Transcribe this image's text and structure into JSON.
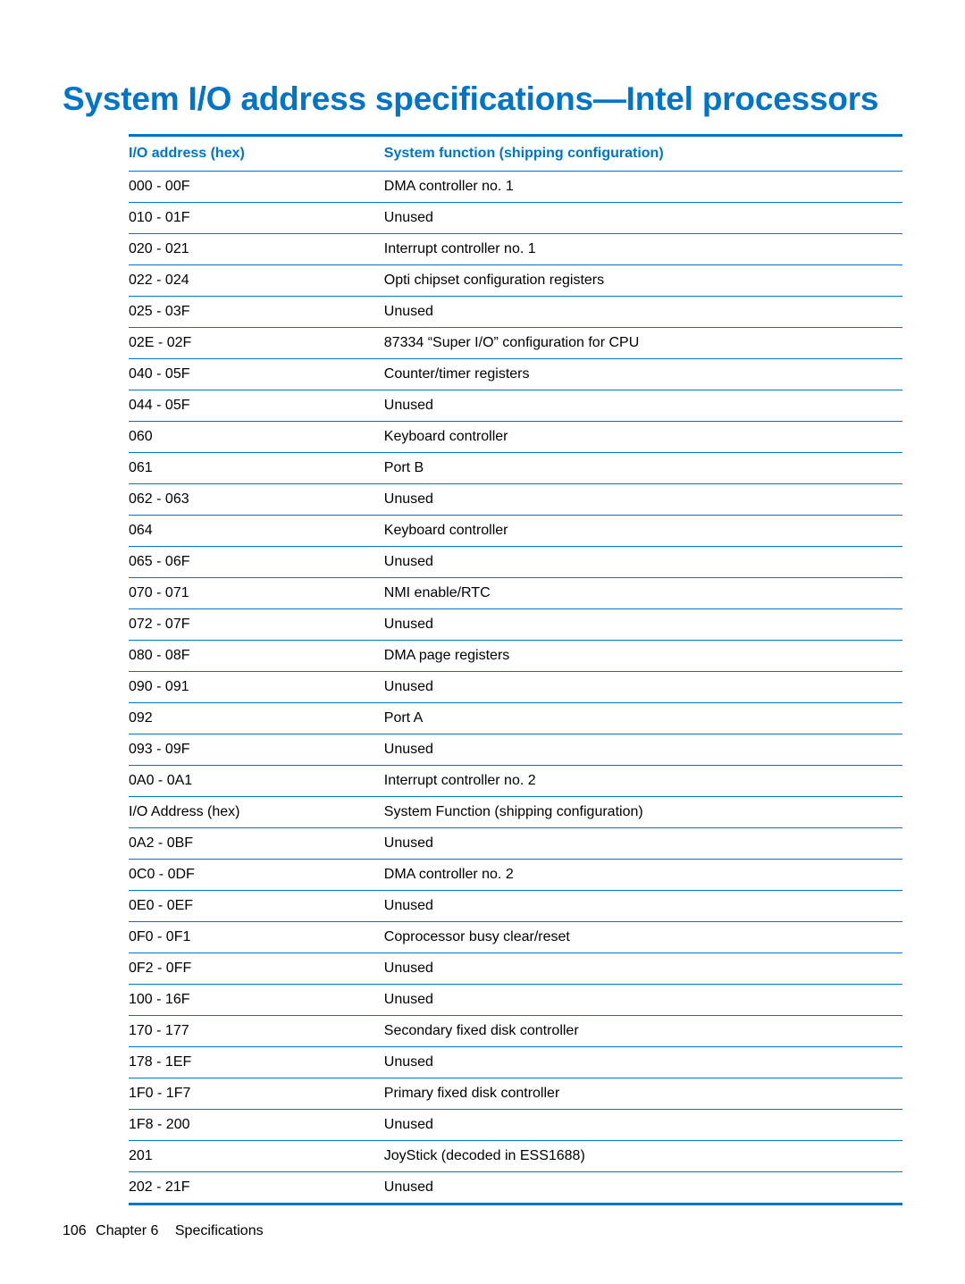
{
  "heading": "System I/O address specifications—Intel processors",
  "table": {
    "header": {
      "addr": "I/O address (hex)",
      "func": "System function (shipping configuration)"
    },
    "rows": [
      {
        "addr": "000 - 00F",
        "func": "DMA controller no. 1"
      },
      {
        "addr": "010 - 01F",
        "func": "Unused"
      },
      {
        "addr": "020 - 021",
        "func": "Interrupt controller no. 1"
      },
      {
        "addr": "022 - 024",
        "func": "Opti chipset configuration registers"
      },
      {
        "addr": "025 - 03F",
        "func": "Unused"
      },
      {
        "addr": "02E - 02F",
        "func": "87334 “Super I/O” configuration for CPU"
      },
      {
        "addr": "040 - 05F",
        "func": "Counter/timer registers"
      },
      {
        "addr": "044 - 05F",
        "func": "Unused"
      },
      {
        "addr": "060",
        "func": "Keyboard controller"
      },
      {
        "addr": "061",
        "func": "Port B"
      },
      {
        "addr": "062 - 063",
        "func": "Unused"
      },
      {
        "addr": "064",
        "func": "Keyboard controller"
      },
      {
        "addr": "065 - 06F",
        "func": "Unused"
      },
      {
        "addr": "070 - 071",
        "func": "NMI enable/RTC"
      },
      {
        "addr": "072 - 07F",
        "func": "Unused"
      },
      {
        "addr": "080 - 08F",
        "func": "DMA page registers"
      },
      {
        "addr": "090 - 091",
        "func": "Unused"
      },
      {
        "addr": "092",
        "func": "Port A"
      },
      {
        "addr": "093 - 09F",
        "func": "Unused"
      },
      {
        "addr": "0A0 - 0A1",
        "func": "Interrupt controller no. 2"
      },
      {
        "addr": "I/O Address (hex)",
        "func": "System Function (shipping configuration)"
      },
      {
        "addr": "0A2 - 0BF",
        "func": "Unused"
      },
      {
        "addr": "0C0 - 0DF",
        "func": "DMA controller no. 2"
      },
      {
        "addr": "0E0 - 0EF",
        "func": "Unused"
      },
      {
        "addr": "0F0 - 0F1",
        "func": "Coprocessor busy clear/reset"
      },
      {
        "addr": "0F2 - 0FF",
        "func": "Unused"
      },
      {
        "addr": "100 - 16F",
        "func": "Unused"
      },
      {
        "addr": "170 - 177",
        "func": "Secondary fixed disk controller"
      },
      {
        "addr": "178 - 1EF",
        "func": "Unused"
      },
      {
        "addr": "1F0 - 1F7",
        "func": "Primary fixed disk controller"
      },
      {
        "addr": "1F8 - 200",
        "func": "Unused"
      },
      {
        "addr": "201",
        "func": "JoyStick (decoded in ESS1688)"
      },
      {
        "addr": "202 - 21F",
        "func": "Unused"
      }
    ]
  },
  "footer": {
    "page_number": "106",
    "chapter_label": "Chapter 6",
    "section": "Specifications"
  }
}
